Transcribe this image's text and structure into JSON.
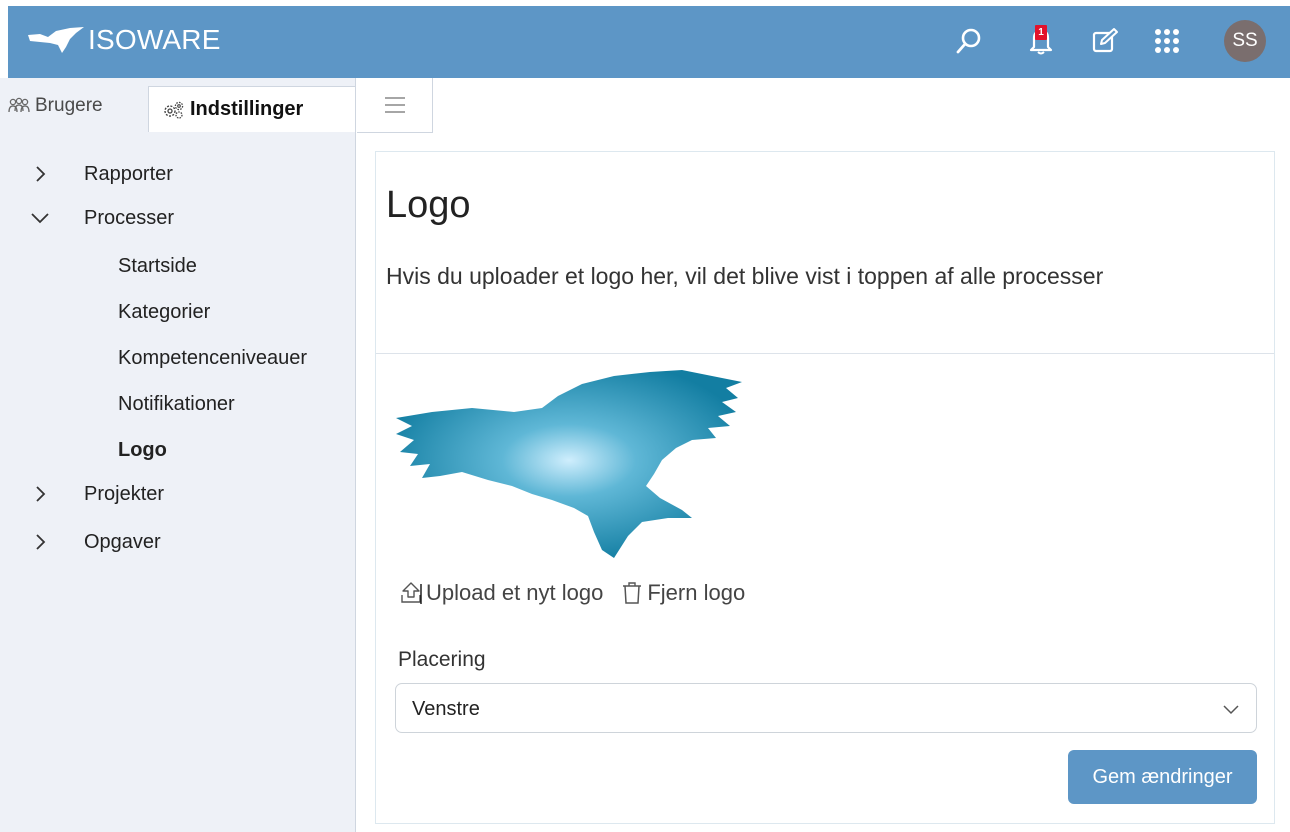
{
  "header": {
    "brand": "ISOWARE",
    "notification_count": "1",
    "avatar_initials": "SS",
    "icons": [
      "search-icon",
      "bell-icon",
      "edit-icon",
      "apps-grid-icon"
    ],
    "bar_color": "#5d96c6"
  },
  "sidebar": {
    "tabs": [
      {
        "label": "Brugere",
        "icon": "users-icon"
      },
      {
        "label": "Indstillinger",
        "icon": "settings-icon"
      }
    ],
    "tree": {
      "rapporter": "Rapporter",
      "processer": "Processer",
      "startside": "Startside",
      "kategorier": "Kategorier",
      "kompetence": "Kompetenceniveauer",
      "notifikationer": "Notifikationer",
      "logo": "Logo",
      "projekter": "Projekter",
      "opgaver": "Opgaver"
    }
  },
  "main": {
    "title": "Logo",
    "description": "Hvis du uploader et logo her, vil det blive vist i toppen af alle processer",
    "upload_label": "Upload et nyt logo",
    "remove_label": "Fjern logo",
    "placement_label": "Placering",
    "placement_value": "Venstre",
    "save_label": "Gem ændringer"
  }
}
